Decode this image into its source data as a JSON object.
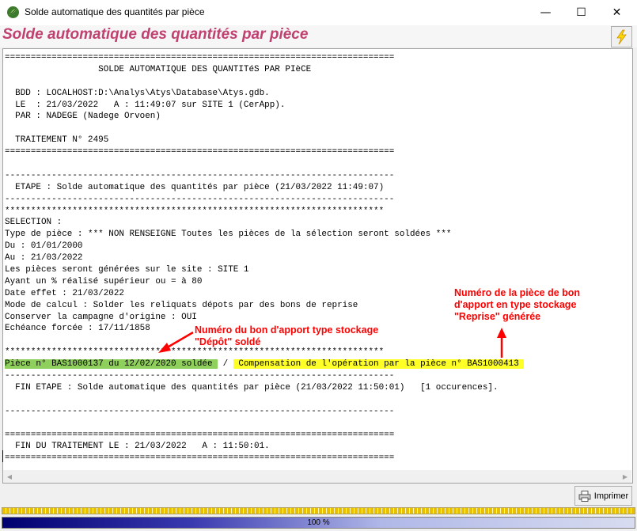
{
  "window": {
    "title": "Solde automatique des quantités par pièce",
    "minimize_glyph": "—",
    "maximize_glyph": "☐",
    "close_glyph": "✕"
  },
  "header": {
    "heading": "Solde automatique des quantités par pièce",
    "run_icon": "lightning-icon"
  },
  "report": {
    "lines": [
      "===========================================================================",
      "                  SOLDE AUTOMATIQUE DES QUANTITéS PAR PIèCE",
      "",
      "  BDD : LOCALHOST:D:\\Analys\\Atys\\Database\\Atys.gdb.",
      "  LE  : 21/03/2022   A : 11:49:07 sur SITE 1 (CerApp).",
      "  PAR : NADEGE (Nadege Orvoen)",
      "",
      "  TRAITEMENT N° 2495",
      "===========================================================================",
      "",
      "---------------------------------------------------------------------------",
      "  ETAPE : Solde automatique des quantités par pièce (21/03/2022 11:49:07)",
      "---------------------------------------------------------------------------",
      "*************************************************************************",
      "SELECTION :",
      "Type de pièce : *** NON RENSEIGNE Toutes les pièces de la sélection seront soldées ***",
      "Du : 01/01/2000",
      "Au : 21/03/2022",
      "Les pièces seront générées sur le site : SITE 1",
      "Ayant un % réalisé supérieur ou = à 80",
      "Date effet : 21/03/2022",
      "Mode de calcul : Solder les reliquats dépots par des bons de reprise",
      "Conserver la campagne d'origine : OUI",
      "Echéance forcée : 17/11/1858",
      "",
      "*************************************************************************"
    ],
    "highlight_line": {
      "green_part": "Pièce n° BAS1000137 du 12/02/2020 soldée ",
      "separator": " / ",
      "yellow_part": " Compensation de l'opération par la pièce n° BAS1000413 "
    },
    "lines_after": [
      "---------------------------------------------------------------------------",
      "  FIN ETAPE : Solde automatique des quantités par pièce (21/03/2022 11:50:01)   [1 occurences].",
      "",
      "---------------------------------------------------------------------------",
      "",
      "===========================================================================",
      "  FIN DU TRAITEMENT LE : 21/03/2022   A : 11:50:01.",
      "==========================================================================="
    ]
  },
  "annotations": {
    "depot": [
      "Numéro du bon d'apport type stockage",
      "\"Dépôt\" soldé"
    ],
    "reprise": [
      "Numéro de la pièce de bon",
      "d'apport en type stockage",
      "\"Reprise\" générée"
    ]
  },
  "footer": {
    "print_label": "Imprimer",
    "progress_text": "100 %",
    "progress_value": 100
  },
  "colors": {
    "heading": "#c04070",
    "annotation": "#ff0000",
    "highlight_green": "#8fcf5c",
    "highlight_yellow": "#ffff28"
  }
}
